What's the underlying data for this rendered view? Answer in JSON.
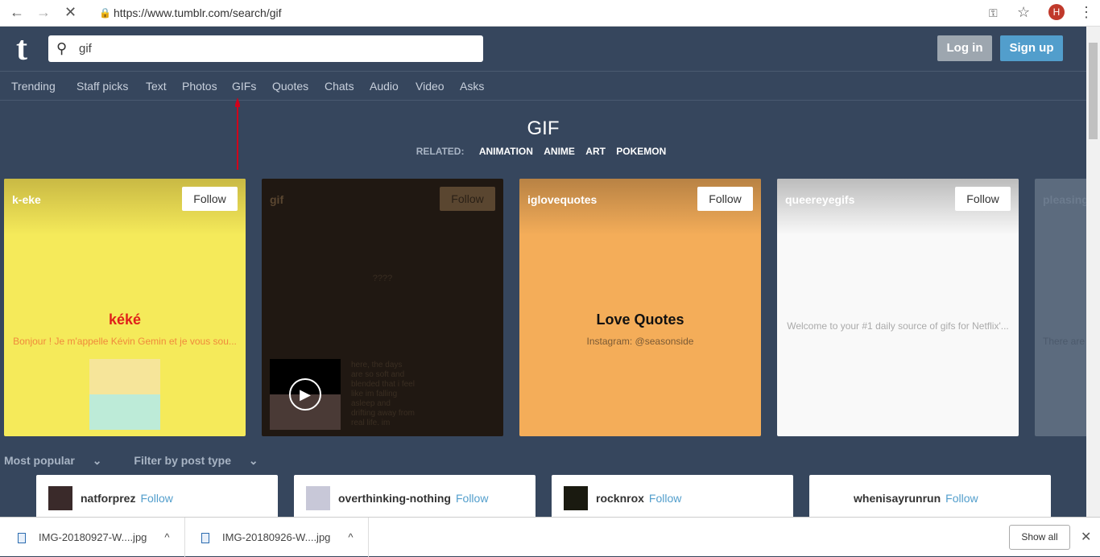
{
  "browser": {
    "url": "https://www.tumblr.com/search/gif",
    "profile_initial": "H"
  },
  "header": {
    "logo": "t",
    "search_value": "gif",
    "login": "Log in",
    "signup": "Sign up"
  },
  "nav": [
    "Trending",
    "Staff picks",
    "Text",
    "Photos",
    "GIFs",
    "Quotes",
    "Chats",
    "Audio",
    "Video",
    "Asks"
  ],
  "search": {
    "title": "GIF",
    "related_label": "RELATED:",
    "related": [
      "ANIMATION",
      "ANIME",
      "ART",
      "POKEMON"
    ]
  },
  "cards": [
    {
      "name": "k-eke",
      "follow": "Follow",
      "title": "kéké",
      "desc": "Bonjour ! Je m'appelle Kévin Gemin et je vous sou...",
      "bg": "#f5ea5a"
    },
    {
      "name": "gif",
      "follow": "Follow",
      "title": "????",
      "desc": "here, the days are so soft and blended that i feel like im falling asleep and drifting away from real life. im",
      "bg": "#201812"
    },
    {
      "name": "iglovequotes",
      "follow": "Follow",
      "title": "Love Quotes",
      "desc": "Instagram: @seasonside",
      "bg": "#f4ad59"
    },
    {
      "name": "queereyegifs",
      "follow": "Follow",
      "desc": "Welcome to your #1 daily source of gifs for Netflix'...",
      "bg": "#f9f9f9"
    },
    {
      "name": "pleasing",
      "desc": "There are",
      "bg": "#5c6b7e"
    }
  ],
  "filters": {
    "sort": "Most popular",
    "type": "Filter by post type"
  },
  "blogs": [
    {
      "name": "natforprez",
      "follow": "Follow"
    },
    {
      "name": "overthinking-nothing",
      "follow": "Follow"
    },
    {
      "name": "rocknrox",
      "follow": "Follow"
    },
    {
      "name": "whenisayrunrun",
      "follow": "Follow"
    }
  ],
  "downloads": {
    "items": [
      "IMG-20180927-W....jpg",
      "IMG-20180926-W....jpg"
    ],
    "show_all": "Show all"
  }
}
